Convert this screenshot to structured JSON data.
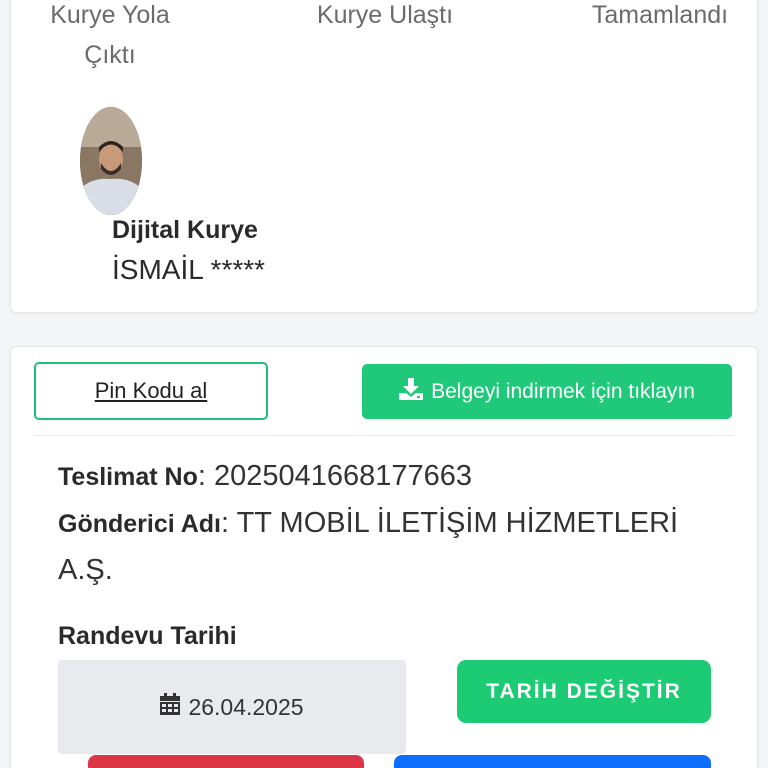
{
  "status_steps": {
    "step1": "Kurye Yola Çıktı",
    "step2": "Kurye Ulaştı",
    "step3": "Tamamlandı"
  },
  "courier": {
    "title": "Dijital Kurye",
    "name": "İSMAİL *****"
  },
  "actions": {
    "pin_label": "Pin Kodu al",
    "download_label": "Belgeyi indirmek için tıklayın",
    "download_icon": "download-icon"
  },
  "delivery": {
    "no_label": "Teslimat No",
    "no_value": ": 2025041668177663",
    "sender_label": "Gönderici Adı",
    "sender_value": ": TT MOBİL İLETİŞİM HİZMETLERİ A.Ş."
  },
  "appointment": {
    "label": "Randevu Tarihi",
    "date": "26.04.2025",
    "date_icon": "calendar-icon",
    "change_label": "TARİH DEĞİŞTİR"
  },
  "colors": {
    "primary_green": "#20c97a",
    "danger_red": "#dc3545",
    "primary_blue": "#0d6efd"
  }
}
